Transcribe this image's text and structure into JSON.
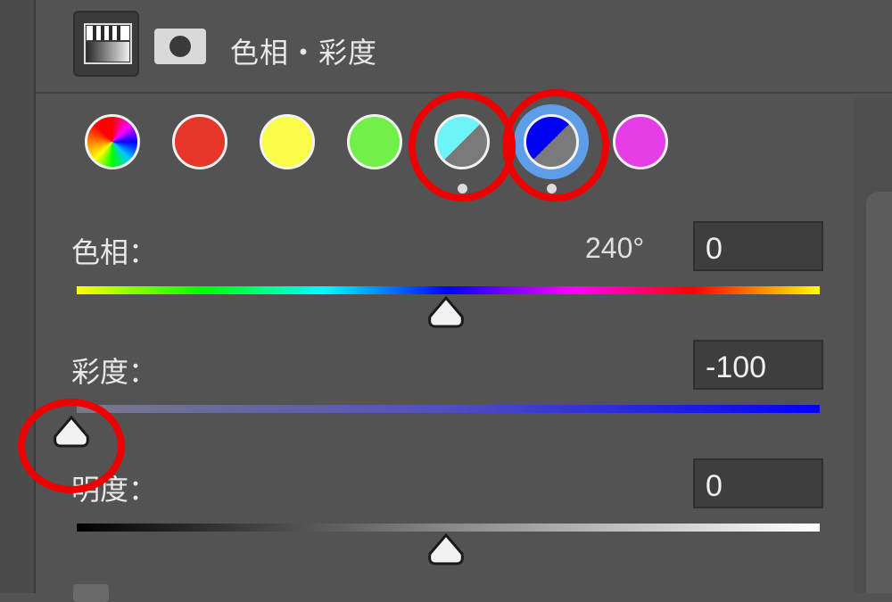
{
  "header": {
    "title": "色相・彩度",
    "adjustment_icon": "hue-saturation-adjustment-icon",
    "mask_icon": "layer-mask-icon"
  },
  "swatches": [
    {
      "name": "master",
      "colors": [
        "#ff0000",
        "#00c8ff"
      ]
    },
    {
      "name": "reds",
      "color": "#e8352a"
    },
    {
      "name": "yellows",
      "color": "#fbfb4a"
    },
    {
      "name": "greens",
      "color": "#72f04a"
    },
    {
      "name": "cyans",
      "color": "#6ef3f8",
      "secondary": "#7a7a7a",
      "edited": true,
      "highlighted": true
    },
    {
      "name": "blues",
      "color": "#0000f0",
      "secondary": "#7a7a7a",
      "edited": true,
      "selected": true,
      "highlighted": true
    },
    {
      "name": "magentas",
      "color": "#e63ee6"
    }
  ],
  "hue": {
    "label": "色相：",
    "degree_readout": "240°",
    "value": "0",
    "slider_fraction": 0.5
  },
  "saturation": {
    "label": "彩度：",
    "value": "-100",
    "slider_fraction": 0.0,
    "highlighted": true
  },
  "lightness": {
    "label": "明度：",
    "value": "0",
    "slider_fraction": 0.5
  },
  "colors": {
    "panel_bg": "#535353",
    "annotation_red": "#ee0000",
    "selection_blue": "#5e9ee8"
  }
}
